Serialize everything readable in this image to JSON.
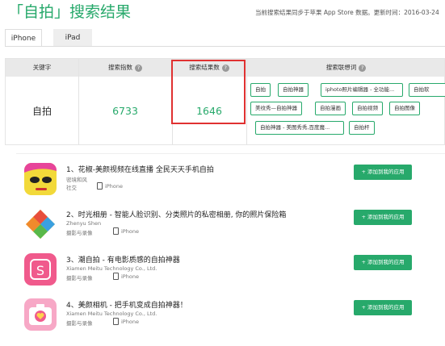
{
  "header": {
    "title": "「自拍」搜索结果",
    "subtitle": "当前搜索结果同步于苹果 App Store 数据。更新时间：2016-03-24"
  },
  "tabs": [
    {
      "label": "iPhone",
      "active": true
    },
    {
      "label": "iPad",
      "active": false
    }
  ],
  "table": {
    "headers": {
      "keyword": "关键字",
      "index": "搜索指数",
      "results": "搜索结果数",
      "assoc": "搜索联想词"
    },
    "row": {
      "keyword": "自拍",
      "index": "6733",
      "results": "1646"
    },
    "assoc_tags": [
      "自拍",
      "自拍神器",
      "iphoto照片编辑器 - 全功能...",
      "自拍软",
      "美纹秀—自拍神器",
      "自拍漫画",
      "自拍视频",
      "自拍图像",
      "自拍神器 - 美图秀秀,百度魔...",
      "自拍杆"
    ]
  },
  "apps": [
    {
      "name": "1、花椒-美颜视频在线直播 全民天天手机自拍",
      "developer": "密境和风",
      "category": "社交",
      "device": "iPhone",
      "button": "+ 添加到我的应用"
    },
    {
      "name": "2、时光相册 - 智能人脸识别、分类照片的私密相册, 你的照片保险箱",
      "developer": "Zhenyu Shen",
      "category": "摄影与录像",
      "device": "iPhone",
      "button": "+ 添加到我的应用"
    },
    {
      "name": "3、潮自拍 - 有电影质感的自拍神器",
      "developer": "Xiamen Meitu Technology Co., Ltd.",
      "category": "摄影与录像",
      "device": "iPhone",
      "button": "+ 添加到我的应用"
    },
    {
      "name": "4、美颜相机 - 把手机变成自拍神器！",
      "developer": "Xiamen Meitu Technology Co., Ltd.",
      "category": "摄影与录像",
      "device": "iPhone",
      "button": "+ 添加到我的应用"
    }
  ],
  "colors": {
    "accent": "#27a96b",
    "highlight": "#e03131"
  }
}
